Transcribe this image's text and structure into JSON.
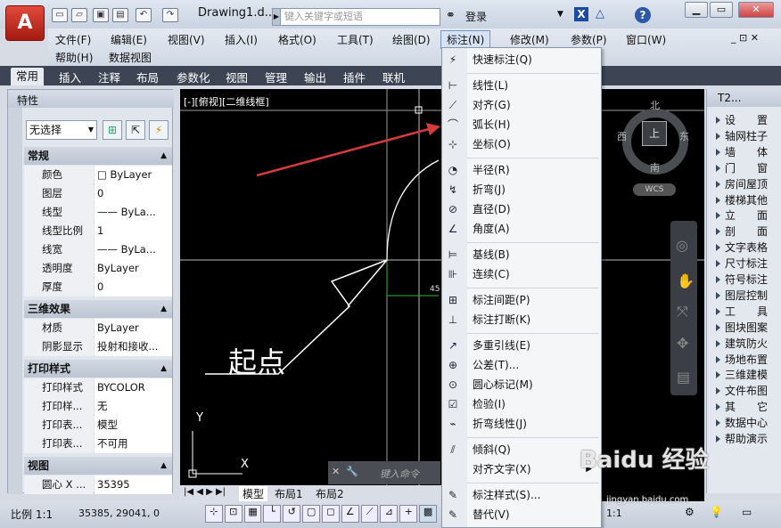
{
  "title_bar": {
    "app_letter": "A",
    "doc_title": "Drawing1.d...",
    "search_placeholder": "键入关键字或短语",
    "login": "登录",
    "help": "?",
    "win_min": "▁",
    "win_max": "▭",
    "win_close": "✕"
  },
  "menubar": {
    "items": [
      "文件(F)",
      "编辑(E)",
      "视图(V)",
      "插入(I)",
      "格式(O)",
      "工具(T)",
      "绘图(D)",
      "标注(N)",
      "修改(M)",
      "参数(P)",
      "窗口(W)"
    ],
    "row2": [
      "帮助(H)",
      "数据视图"
    ],
    "selected": "标注(N)"
  },
  "ribbon": {
    "tabs": [
      "常用",
      "插入",
      "注释",
      "布局",
      "参数化",
      "视图",
      "管理",
      "输出",
      "插件",
      "联机"
    ],
    "active": "常用"
  },
  "properties": {
    "title": "特性",
    "selection": "无选择",
    "sections": [
      {
        "name": "常规",
        "rows": [
          [
            "颜色",
            "□ ByLayer"
          ],
          [
            "图层",
            "0"
          ],
          [
            "线型",
            "—— ByLa..."
          ],
          [
            "线型比例",
            "1"
          ],
          [
            "线宽",
            "—— ByLa..."
          ],
          [
            "透明度",
            "ByLayer"
          ],
          [
            "厚度",
            "0"
          ]
        ]
      },
      {
        "name": "三维效果",
        "rows": [
          [
            "材质",
            "ByLayer"
          ],
          [
            "阴影显示",
            "投射和接收..."
          ]
        ]
      },
      {
        "name": "打印样式",
        "rows": [
          [
            "打印样式",
            "BYCOLOR"
          ],
          [
            "打印样...",
            "无"
          ],
          [
            "打印表...",
            "模型"
          ],
          [
            "打印表...",
            "不可用"
          ]
        ]
      },
      {
        "name": "视图",
        "rows": [
          [
            "圆心 X ...",
            "35395"
          ]
        ]
      }
    ]
  },
  "canvas": {
    "viewport_label": "[-][俯视][二维线框]",
    "annotation_text": "起点",
    "dim_value": "45",
    "viewcube": {
      "n": "北",
      "s": "南",
      "e": "东",
      "w": "西",
      "top": "上",
      "wcs": "WCS"
    },
    "ucs_y": "Y",
    "ucs_x": "X",
    "cmd_prompt": "键入命令"
  },
  "layout_tabs": [
    "模型",
    "布局1",
    "布局2"
  ],
  "right_panel": {
    "title": "T2...",
    "items": [
      "设　　置",
      "轴网柱子",
      "墙　　体",
      "门　　窗",
      "房间屋顶",
      "楼梯其他",
      "立　　面",
      "剖　　面",
      "文字表格",
      "尺寸标注",
      "符号标注",
      "图层控制",
      "工　　具",
      "图块图案",
      "建筑防火",
      "场地布置",
      "三维建模",
      "文件布图",
      "其　　它",
      "数据中心",
      "帮助演示"
    ]
  },
  "status": {
    "scale": "比例 1:1",
    "coords": "35385, 29041, 0",
    "scale_right": "1:1"
  },
  "dropdown": {
    "items": [
      {
        "label": "快速标注(Q)",
        "icon": "⚡"
      },
      {
        "sep": true
      },
      {
        "label": "线性(L)",
        "icon": "⊢"
      },
      {
        "label": "对齐(G)",
        "icon": "⟋"
      },
      {
        "label": "弧长(H)",
        "icon": "⌒"
      },
      {
        "label": "坐标(O)",
        "icon": "⊹"
      },
      {
        "sep": true
      },
      {
        "label": "半径(R)",
        "icon": "◔"
      },
      {
        "label": "折弯(J)",
        "icon": "↯"
      },
      {
        "label": "直径(D)",
        "icon": "⊘"
      },
      {
        "label": "角度(A)",
        "icon": "∠"
      },
      {
        "sep": true
      },
      {
        "label": "基线(B)",
        "icon": "⊨"
      },
      {
        "label": "连续(C)",
        "icon": "⊪"
      },
      {
        "sep": true
      },
      {
        "label": "标注间距(P)",
        "icon": "⊞"
      },
      {
        "label": "标注打断(K)",
        "icon": "⊥"
      },
      {
        "sep": true
      },
      {
        "label": "多重引线(E)",
        "icon": "↗"
      },
      {
        "label": "公差(T)...",
        "icon": "⊕"
      },
      {
        "label": "圆心标记(M)",
        "icon": "⊙"
      },
      {
        "label": "检验(I)",
        "icon": "☑"
      },
      {
        "label": "折弯线性(J)",
        "icon": "⌁"
      },
      {
        "sep": true
      },
      {
        "label": "倾斜(Q)",
        "icon": "⫽"
      },
      {
        "label": "对齐文字(X)",
        "icon": "",
        "submenu": true
      },
      {
        "sep": true
      },
      {
        "label": "标注样式(S)...",
        "icon": "✎"
      },
      {
        "label": "替代(V)",
        "icon": "✎"
      }
    ]
  },
  "watermark": "Baidu 经验",
  "watermark_url": "jingyan.baidu.com"
}
